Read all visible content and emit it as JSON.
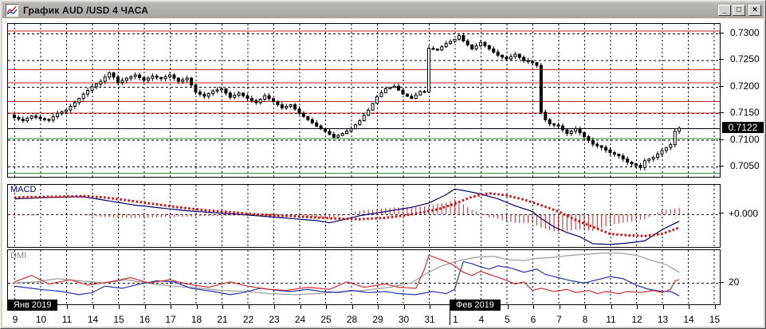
{
  "window": {
    "title": "График AUD /USD  4 ЧАСА",
    "controls": {
      "minimize": "_",
      "maximize": "□",
      "close": "×"
    }
  },
  "colors": {
    "level_red": "#c22424",
    "level_green": "#2e8b3a",
    "current_line": "#000000",
    "macd_line": "#000066",
    "signal_line": "#cc1111",
    "histogram": "#cc2222",
    "dmi_red": "#c83232",
    "dmi_blue": "#2535a8",
    "dmi_gray": "#9a9a9a",
    "grid": "#000000"
  },
  "price_axis": {
    "labels": [
      "0.7300",
      "0.7250",
      "0.7200",
      "0.7150",
      "0.7100",
      "0.7050"
    ],
    "current_price": "0.7122"
  },
  "macd_panel": {
    "label": "MACD",
    "zero_label": "+0.000"
  },
  "dmi_panel": {
    "label": "DMI",
    "level_label": "20"
  },
  "x_axis": {
    "month_labels": [
      "Янв 2019",
      "Фев 2019"
    ],
    "day_labels": [
      "9",
      "10",
      "11",
      "14",
      "15",
      "16",
      "17",
      "18",
      "21",
      "22",
      "23",
      "24",
      "25",
      "28",
      "29",
      "30",
      "31",
      "1",
      "4",
      "5",
      "6",
      "7",
      "8",
      "11",
      "12",
      "13",
      "14",
      "15"
    ]
  },
  "chart_data": {
    "type": "candlestick",
    "instrument": "AUD/USD",
    "timeframe": "4H",
    "bars_per_day": 6,
    "num_bars": 155,
    "price_panel": {
      "ylim": [
        0.70305,
        0.7318
      ],
      "grid_prices": [
        0.73,
        0.725,
        0.72,
        0.715,
        0.71,
        0.705
      ],
      "levels": [
        {
          "price": 0.7305,
          "color": "red"
        },
        {
          "price": 0.7233,
          "color": "red"
        },
        {
          "price": 0.7208,
          "color": "red"
        },
        {
          "price": 0.7173,
          "color": "red"
        },
        {
          "price": 0.7151,
          "color": "red"
        },
        {
          "price": 0.7103,
          "color": "green"
        },
        {
          "price": 0.7038,
          "color": "green"
        }
      ],
      "current_price": 0.7122,
      "close_keypoints": [
        [
          0,
          0.7142
        ],
        [
          2,
          0.7136
        ],
        [
          4,
          0.7145
        ],
        [
          6,
          0.714
        ],
        [
          8,
          0.7137
        ],
        [
          10,
          0.715
        ],
        [
          12,
          0.7156
        ],
        [
          14,
          0.717
        ],
        [
          16,
          0.7186
        ],
        [
          18,
          0.72
        ],
        [
          20,
          0.721
        ],
        [
          22,
          0.7226
        ],
        [
          23,
          0.7218
        ],
        [
          24,
          0.7208
        ],
        [
          26,
          0.7216
        ],
        [
          28,
          0.7222
        ],
        [
          30,
          0.7212
        ],
        [
          32,
          0.722
        ],
        [
          34,
          0.7215
        ],
        [
          36,
          0.7222
        ],
        [
          38,
          0.721
        ],
        [
          40,
          0.7216
        ],
        [
          42,
          0.719
        ],
        [
          44,
          0.7182
        ],
        [
          46,
          0.7192
        ],
        [
          48,
          0.7196
        ],
        [
          50,
          0.718
        ],
        [
          52,
          0.7188
        ],
        [
          54,
          0.7178
        ],
        [
          56,
          0.717
        ],
        [
          58,
          0.7183
        ],
        [
          60,
          0.7172
        ],
        [
          62,
          0.716
        ],
        [
          64,
          0.7166
        ],
        [
          66,
          0.715
        ],
        [
          68,
          0.7138
        ],
        [
          70,
          0.7126
        ],
        [
          72,
          0.7116
        ],
        [
          74,
          0.7105
        ],
        [
          76,
          0.7112
        ],
        [
          78,
          0.7121
        ],
        [
          80,
          0.7136
        ],
        [
          82,
          0.7156
        ],
        [
          84,
          0.7181
        ],
        [
          86,
          0.7196
        ],
        [
          88,
          0.7201
        ],
        [
          90,
          0.7186
        ],
        [
          92,
          0.7178
        ],
        [
          94,
          0.7191
        ],
        [
          95,
          0.719
        ],
        [
          96,
          0.7272
        ],
        [
          98,
          0.7269
        ],
        [
          100,
          0.7281
        ],
        [
          102,
          0.7289
        ],
        [
          103,
          0.7296
        ],
        [
          104,
          0.7286
        ],
        [
          106,
          0.7271
        ],
        [
          108,
          0.7283
        ],
        [
          110,
          0.7271
        ],
        [
          112,
          0.7259
        ],
        [
          114,
          0.7252
        ],
        [
          116,
          0.7261
        ],
        [
          118,
          0.7249
        ],
        [
          120,
          0.7245
        ],
        [
          121,
          0.724
        ],
        [
          122,
          0.7152
        ],
        [
          123,
          0.7138
        ],
        [
          124,
          0.713
        ],
        [
          126,
          0.7126
        ],
        [
          128,
          0.7112
        ],
        [
          130,
          0.7121
        ],
        [
          132,
          0.7106
        ],
        [
          134,
          0.7092
        ],
        [
          136,
          0.7086
        ],
        [
          138,
          0.7076
        ],
        [
          140,
          0.707
        ],
        [
          142,
          0.7058
        ],
        [
          144,
          0.7052
        ],
        [
          145,
          0.7048
        ],
        [
          146,
          0.7061
        ],
        [
          148,
          0.7067
        ],
        [
          150,
          0.708
        ],
        [
          152,
          0.7091
        ],
        [
          153,
          0.7116
        ],
        [
          154,
          0.7122
        ]
      ]
    },
    "macd": {
      "units": "0.0001",
      "zero_label_value": "+0.000",
      "line_keypoints": [
        [
          0,
          22
        ],
        [
          8,
          24
        ],
        [
          16,
          25
        ],
        [
          21,
          20
        ],
        [
          28,
          13
        ],
        [
          34,
          9
        ],
        [
          40,
          5
        ],
        [
          47,
          2
        ],
        [
          52,
          0
        ],
        [
          58,
          -3
        ],
        [
          64,
          -6
        ],
        [
          70,
          -9
        ],
        [
          73,
          -12
        ],
        [
          76,
          -8
        ],
        [
          80,
          -2
        ],
        [
          84,
          2
        ],
        [
          88,
          6
        ],
        [
          92,
          10
        ],
        [
          96,
          16
        ],
        [
          100,
          28
        ],
        [
          102,
          36
        ],
        [
          104,
          34
        ],
        [
          108,
          29
        ],
        [
          112,
          22
        ],
        [
          116,
          12
        ],
        [
          120,
          4
        ],
        [
          122,
          -6
        ],
        [
          125,
          -18
        ],
        [
          128,
          -26
        ],
        [
          131,
          -32
        ],
        [
          134,
          -42
        ],
        [
          138,
          -43
        ],
        [
          142,
          -41
        ],
        [
          146,
          -38
        ],
        [
          150,
          -22
        ],
        [
          154,
          -10
        ]
      ],
      "signal_keypoints": [
        [
          0,
          24
        ],
        [
          8,
          25
        ],
        [
          16,
          26
        ],
        [
          21,
          24
        ],
        [
          26,
          20
        ],
        [
          32,
          15
        ],
        [
          38,
          10
        ],
        [
          44,
          6
        ],
        [
          50,
          3
        ],
        [
          56,
          0
        ],
        [
          62,
          -2
        ],
        [
          68,
          -4
        ],
        [
          74,
          -6
        ],
        [
          80,
          -7
        ],
        [
          86,
          -5
        ],
        [
          90,
          -2
        ],
        [
          94,
          2
        ],
        [
          98,
          7
        ],
        [
          102,
          15
        ],
        [
          106,
          25
        ],
        [
          110,
          30
        ],
        [
          114,
          27
        ],
        [
          118,
          21
        ],
        [
          122,
          13
        ],
        [
          126,
          4
        ],
        [
          130,
          -8
        ],
        [
          134,
          -18
        ],
        [
          138,
          -28
        ],
        [
          142,
          -30
        ],
        [
          146,
          -31
        ],
        [
          150,
          -28
        ],
        [
          154,
          -19
        ]
      ]
    },
    "dmi": {
      "level": 20,
      "red_keypoints": [
        [
          0,
          21
        ],
        [
          4,
          27
        ],
        [
          8,
          19
        ],
        [
          13,
          23
        ],
        [
          17,
          18
        ],
        [
          22,
          21
        ],
        [
          27,
          25
        ],
        [
          31,
          20
        ],
        [
          36,
          23
        ],
        [
          40,
          19
        ],
        [
          45,
          16
        ],
        [
          50,
          21
        ],
        [
          54,
          17
        ],
        [
          59,
          14
        ],
        [
          63,
          13
        ],
        [
          68,
          16
        ],
        [
          73,
          14
        ],
        [
          77,
          21
        ],
        [
          81,
          16
        ],
        [
          86,
          19
        ],
        [
          89,
          16
        ],
        [
          93,
          15
        ],
        [
          94,
          24
        ],
        [
          95,
          33
        ],
        [
          96,
          46
        ],
        [
          98,
          43
        ],
        [
          100,
          40
        ],
        [
          102,
          36
        ],
        [
          104,
          30
        ],
        [
          106,
          27
        ],
        [
          108,
          31
        ],
        [
          110,
          28
        ],
        [
          113,
          24
        ],
        [
          116,
          19
        ],
        [
          118,
          21
        ],
        [
          120,
          13
        ],
        [
          122,
          15
        ],
        [
          125,
          12
        ],
        [
          128,
          14
        ],
        [
          130,
          11
        ],
        [
          133,
          13
        ],
        [
          135,
          10
        ],
        [
          137,
          12
        ],
        [
          140,
          10
        ],
        [
          142,
          12
        ],
        [
          145,
          11
        ],
        [
          148,
          13
        ],
        [
          150,
          11
        ],
        [
          152,
          14
        ],
        [
          153,
          22
        ],
        [
          154,
          23
        ]
      ],
      "blue_keypoints": [
        [
          0,
          17
        ],
        [
          6,
          14
        ],
        [
          11,
          12
        ],
        [
          15,
          9
        ],
        [
          18,
          11
        ],
        [
          21,
          17
        ],
        [
          25,
          15
        ],
        [
          28,
          18
        ],
        [
          33,
          22
        ],
        [
          37,
          21
        ],
        [
          41,
          15
        ],
        [
          46,
          12
        ],
        [
          50,
          9
        ],
        [
          53,
          11
        ],
        [
          57,
          15
        ],
        [
          61,
          13
        ],
        [
          64,
          12
        ],
        [
          68,
          14
        ],
        [
          71,
          12
        ],
        [
          75,
          11
        ],
        [
          78,
          13
        ],
        [
          82,
          11
        ],
        [
          86,
          12
        ],
        [
          89,
          10
        ],
        [
          93,
          9
        ],
        [
          97,
          12
        ],
        [
          100,
          10
        ],
        [
          102,
          14
        ],
        [
          103,
          28
        ],
        [
          104,
          40
        ],
        [
          106,
          38
        ],
        [
          108,
          35
        ],
        [
          110,
          33
        ],
        [
          112,
          36
        ],
        [
          115,
          34
        ],
        [
          118,
          30
        ],
        [
          121,
          33
        ],
        [
          123,
          28
        ],
        [
          126,
          25
        ],
        [
          129,
          22
        ],
        [
          132,
          20
        ],
        [
          135,
          23
        ],
        [
          138,
          26
        ],
        [
          141,
          24
        ],
        [
          144,
          18
        ],
        [
          147,
          14
        ],
        [
          150,
          12
        ],
        [
          152,
          12
        ],
        [
          154,
          8
        ]
      ],
      "gray_keypoints": [
        [
          0,
          20
        ],
        [
          5,
          21
        ],
        [
          10,
          24
        ],
        [
          15,
          22
        ],
        [
          21,
          20
        ],
        [
          26,
          23
        ],
        [
          32,
          19
        ],
        [
          37,
          17
        ],
        [
          43,
          15
        ],
        [
          48,
          13
        ],
        [
          54,
          12
        ],
        [
          59,
          10
        ],
        [
          65,
          9
        ],
        [
          70,
          10
        ],
        [
          76,
          12
        ],
        [
          81,
          13
        ],
        [
          87,
          16
        ],
        [
          92,
          20
        ],
        [
          95,
          28
        ],
        [
          99,
          36
        ],
        [
          103,
          41
        ],
        [
          107,
          44
        ],
        [
          111,
          45
        ],
        [
          114,
          42
        ],
        [
          118,
          41
        ],
        [
          121,
          43
        ],
        [
          125,
          44
        ],
        [
          129,
          46
        ],
        [
          133,
          47
        ],
        [
          136,
          48
        ],
        [
          140,
          48
        ],
        [
          144,
          46
        ],
        [
          147,
          42
        ],
        [
          151,
          37
        ],
        [
          154,
          30
        ]
      ]
    }
  }
}
